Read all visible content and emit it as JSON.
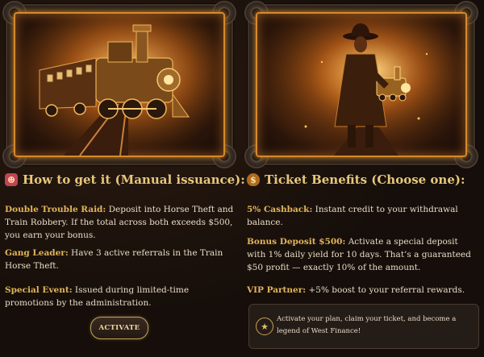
{
  "left": {
    "illustration": "steam-train-illustration",
    "heading": {
      "icon": "gang-emoji-icon",
      "icon_glyph": "☻",
      "title": "How to get it (Manual issuance):"
    },
    "items": [
      {
        "label": "Double Trouble Raid:",
        "text": " Deposit into Horse Theft and Train Robbery. If the total across both exceeds $500, you earn your bonus."
      },
      {
        "label": "Gang Leader:",
        "text": " Have 3 active referrals in the Train Horse Theft."
      },
      {
        "label": "Special Event:",
        "text": " Issued during limited-time promotions by the administration."
      }
    ],
    "button_label": "ACTIVATE"
  },
  "right": {
    "illustration": "cowboy-with-train-illustration",
    "heading": {
      "icon": "money-bag-emoji-icon",
      "icon_glyph": "$",
      "title": "Ticket Benefits (Choose one):"
    },
    "items": [
      {
        "label": "5% Cashback:",
        "text": " Instant credit to your withdrawal balance."
      },
      {
        "label": "Bonus Deposit $500:",
        "text": " Activate a special deposit with 1% daily yield for 10 days. That’s a guaranteed $50 profit — exactly 10% of the amount."
      },
      {
        "label": "VIP Partner:",
        "text": " +5% boost to your referral rewards."
      }
    ],
    "cta": {
      "icon": "sheriff-star-icon",
      "icon_glyph": "★",
      "text": "Activate your plan, claim your ticket, and become a legend of West Finance!"
    }
  },
  "colors": {
    "accent_gold": "#e3b55a",
    "frame_glow": "#d58a2c",
    "background": "#1a120d"
  }
}
